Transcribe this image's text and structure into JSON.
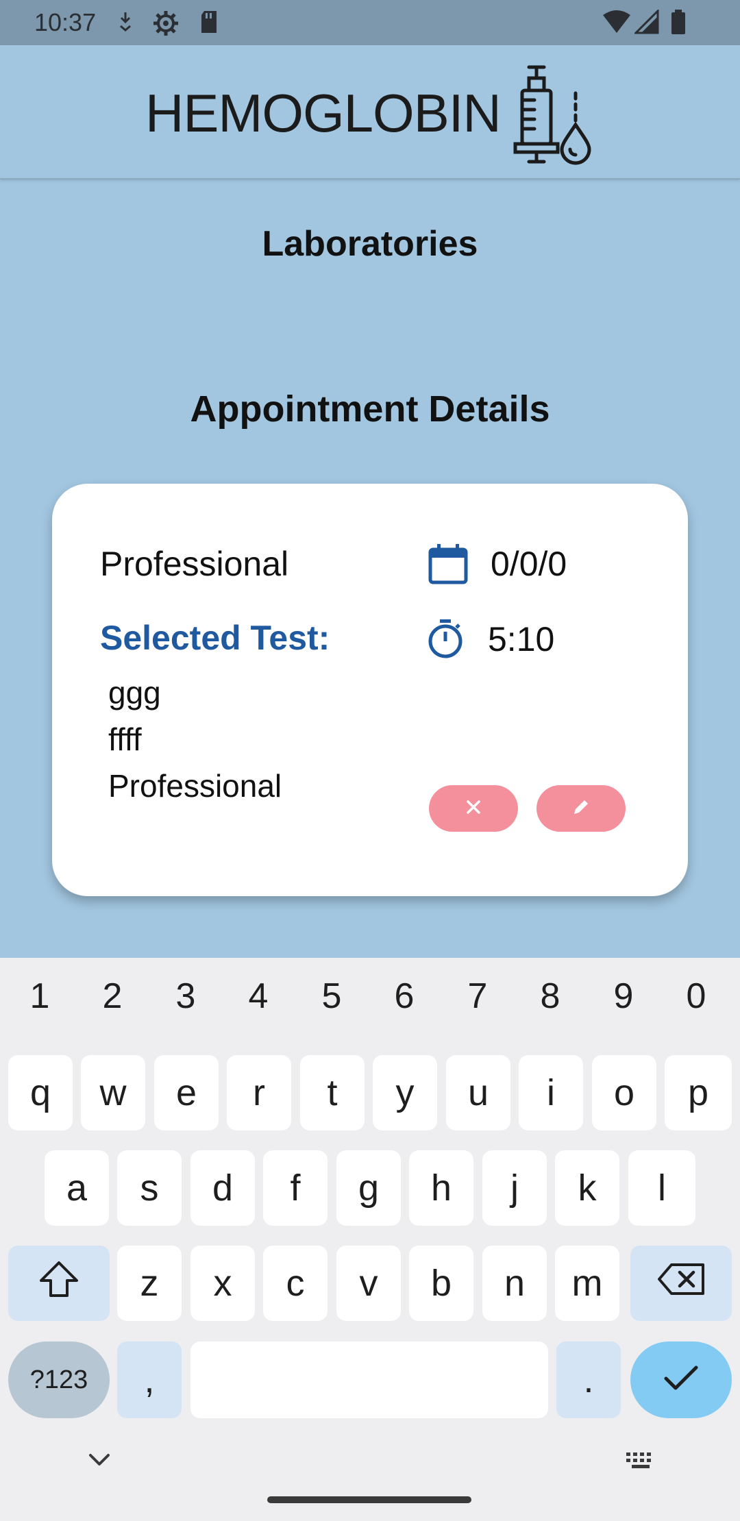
{
  "status_bar": {
    "time": "10:37",
    "icons": [
      "download-icon",
      "settings-icon",
      "sd-card-icon",
      "wifi-icon",
      "signal-icon",
      "battery-icon"
    ]
  },
  "header": {
    "logo_text": "HEMOGLOBIN",
    "logo_icon": "syringe-drop-icon"
  },
  "page": {
    "laboratory_title": "Laboratories",
    "section_title": "Appointment Details"
  },
  "appointment": {
    "laboratory": "Professional",
    "selected_test_label": "Selected Test:",
    "tests": [
      "ggg",
      "ffff",
      "Professional"
    ],
    "date": "0/0/0",
    "time": "5:10",
    "date_icon": "calendar-icon",
    "time_icon": "timer-icon",
    "cancel_icon": "close-icon",
    "edit_icon": "pencil-icon"
  },
  "keyboard": {
    "numbers": [
      "1",
      "2",
      "3",
      "4",
      "5",
      "6",
      "7",
      "8",
      "9",
      "0"
    ],
    "row1": [
      "q",
      "w",
      "e",
      "r",
      "t",
      "y",
      "u",
      "i",
      "o",
      "p"
    ],
    "row2": [
      "a",
      "s",
      "d",
      "f",
      "g",
      "h",
      "j",
      "k",
      "l"
    ],
    "row3": [
      "z",
      "x",
      "c",
      "v",
      "b",
      "n",
      "m"
    ],
    "symbols_label": "?123",
    "comma": ",",
    "period": ".",
    "shift_icon": "shift-icon",
    "backspace_icon": "backspace-icon",
    "enter_icon": "check-icon",
    "hide_icon": "chevron-down-icon",
    "switch_icon": "keyboard-icon"
  },
  "colors": {
    "background": "#a2c6e0",
    "accent_blue": "#1f5aa0",
    "action_pink": "#f4909c",
    "enter_blue": "#83cbf2"
  }
}
